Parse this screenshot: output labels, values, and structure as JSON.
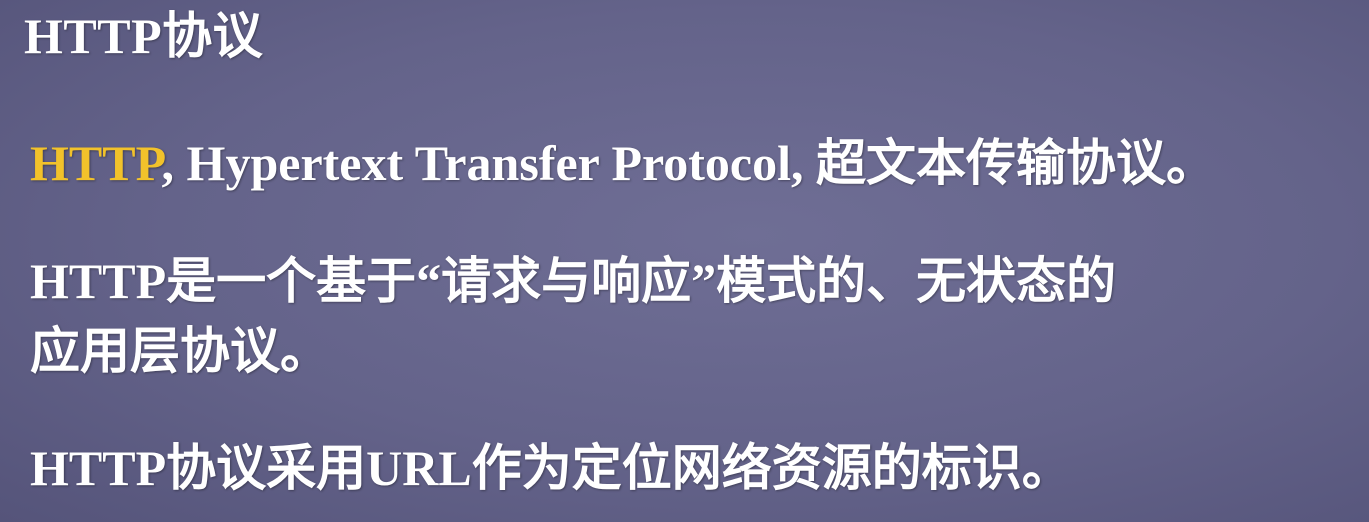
{
  "slide": {
    "title": "HTTP协议",
    "bullets": [
      {
        "highlight": "HTTP",
        "rest": ", Hypertext Transfer Protocol, 超文本传输协议。"
      },
      {
        "line1": "HTTP是一个基于“请求与响应”模式的、无状态的",
        "line2": "应用层协议。"
      },
      {
        "text": "HTTP协议采用URL作为定位网络资源的标识。"
      }
    ]
  },
  "colors": {
    "background": "#64638a",
    "text": "#ffffff",
    "highlight": "#f2c22b"
  }
}
